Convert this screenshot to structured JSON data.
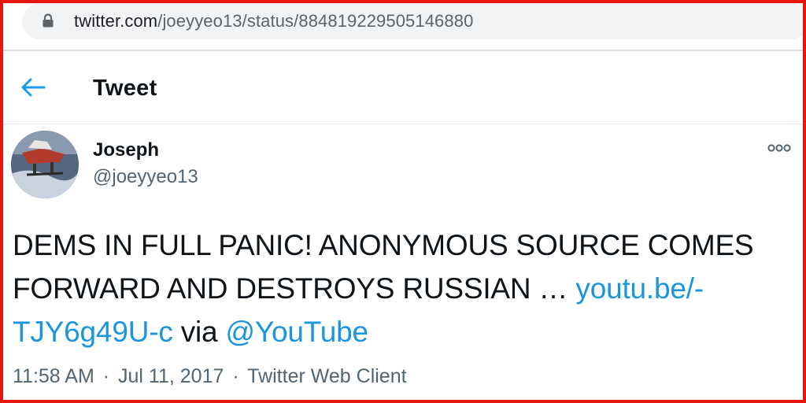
{
  "browser": {
    "url_domain": "twitter.com",
    "url_path": "/joeyyeo13/status/884819229505146880"
  },
  "header": {
    "title": "Tweet"
  },
  "author": {
    "name": "Joseph",
    "handle": "@joeyyeo13"
  },
  "tweet": {
    "text": "DEMS IN FULL PANIC! ANONYMOUS SOURCE COMES FORWARD AND DESTROYS RUSSIAN … ",
    "link": "youtu.be/-TJY6g49U-c",
    "via_label": " via ",
    "mention": "@YouTube"
  },
  "meta": {
    "time": "11:58 AM",
    "sep1": "·",
    "date": "Jul 11, 2017",
    "sep2": "·",
    "source": "Twitter Web Client"
  },
  "colors": {
    "accent": "#1b95e0",
    "frame": "#e8140e"
  },
  "icons": [
    "lock-icon",
    "back-arrow-icon",
    "more-options-icon"
  ]
}
